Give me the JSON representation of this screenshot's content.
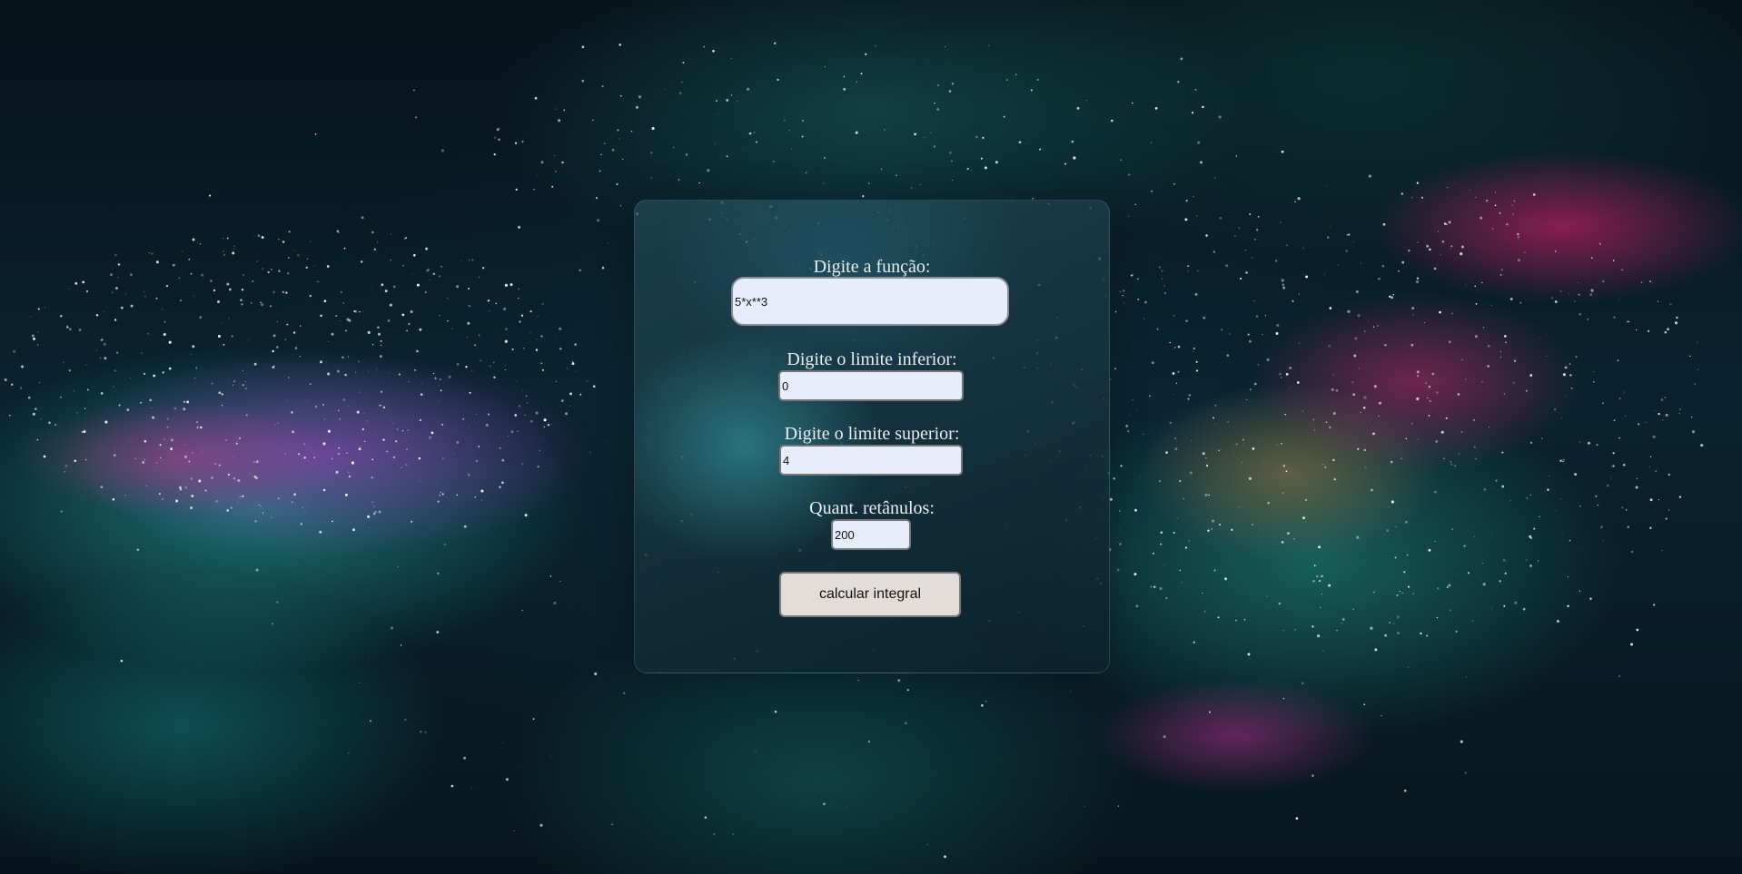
{
  "form": {
    "funcao": {
      "label": "Digite a função:",
      "value": "5*x**3"
    },
    "limite_inferior": {
      "label": "Digite o limite inferior:",
      "value": "0"
    },
    "limite_superior": {
      "label": "Digite o limite superior:",
      "value": "4"
    },
    "retangulos": {
      "label": "Quant. retânulos:",
      "value": "200"
    },
    "submit_label": "calcular integral"
  },
  "colors": {
    "input_background": "#e8edfb",
    "button_background": "#e2ddd9",
    "label_text": "#e8eef2",
    "panel_tint": "#1e4652"
  }
}
